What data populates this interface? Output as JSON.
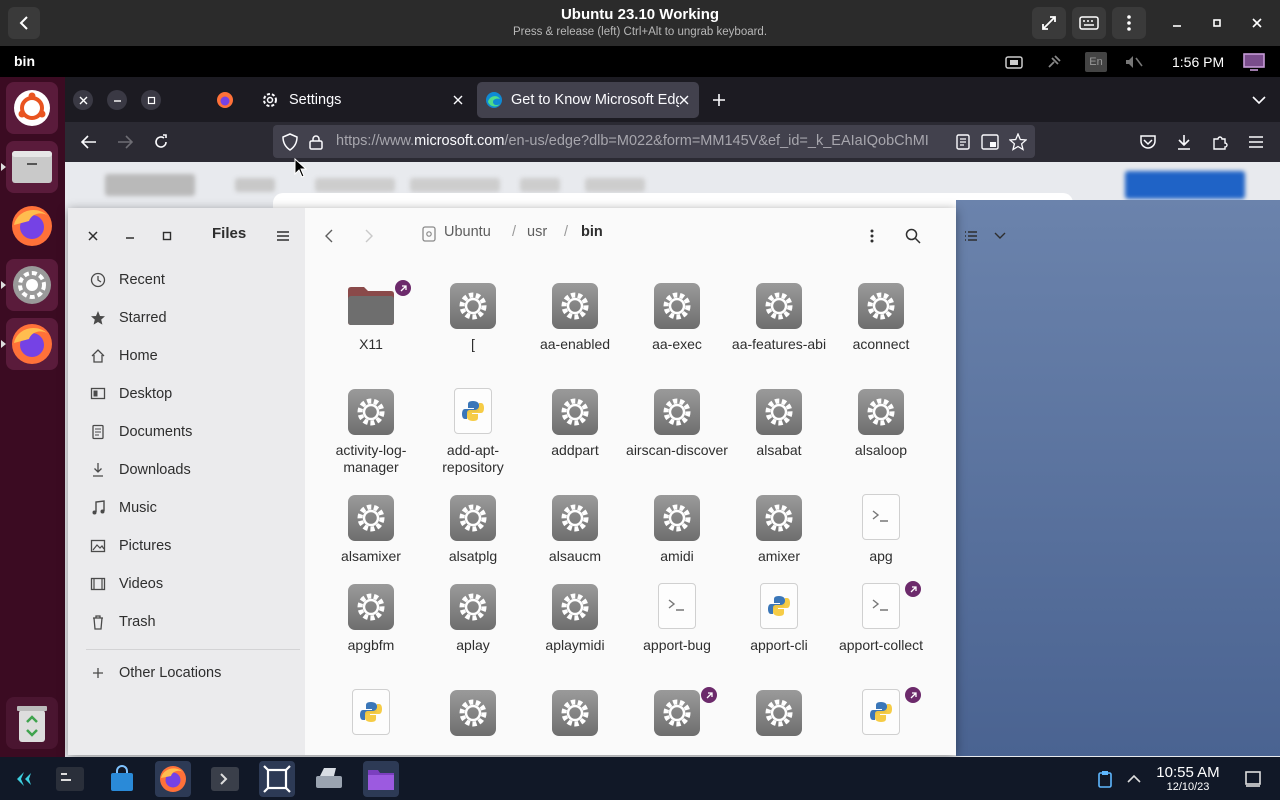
{
  "vm": {
    "title": "Ubuntu 23.10 Working",
    "subtitle": "Press & release (left) Ctrl+Alt to ungrab keyboard."
  },
  "topbar": {
    "app_name": "bin",
    "clock": "1:56 PM",
    "keyboard_layout": "En"
  },
  "firefox": {
    "tabs": [
      {
        "label": "Settings"
      },
      {
        "label": "Get to Know Microsoft Edge"
      }
    ],
    "url_prefix": "https://www.",
    "url_domain": "microsoft.com",
    "url_rest": "/en-us/edge?dlb=M022&form=MM145V&ef_id=_k_EAIaIQobChMI"
  },
  "files": {
    "title": "Files",
    "path": [
      "Ubuntu",
      "usr",
      "bin"
    ],
    "sidebar": [
      {
        "label": "Recent",
        "icon": "clock-icon"
      },
      {
        "label": "Starred",
        "icon": "star-icon"
      },
      {
        "label": "Home",
        "icon": "home-icon"
      },
      {
        "label": "Desktop",
        "icon": "desktop-icon"
      },
      {
        "label": "Documents",
        "icon": "documents-icon"
      },
      {
        "label": "Downloads",
        "icon": "downloads-icon"
      },
      {
        "label": "Music",
        "icon": "music-icon"
      },
      {
        "label": "Pictures",
        "icon": "pictures-icon"
      },
      {
        "label": "Videos",
        "icon": "videos-icon"
      },
      {
        "label": "Trash",
        "icon": "trash-icon"
      }
    ],
    "other_locations": "Other Locations",
    "items": [
      {
        "name": "X11",
        "type": "folder",
        "link": true
      },
      {
        "name": "[",
        "type": "exec",
        "link": false
      },
      {
        "name": "aa-enabled",
        "type": "exec",
        "link": false
      },
      {
        "name": "aa-exec",
        "type": "exec",
        "link": false
      },
      {
        "name": "aa-features-abi",
        "type": "exec",
        "link": false
      },
      {
        "name": "aconnect",
        "type": "exec",
        "link": false
      },
      {
        "name": "activity-log-manager",
        "type": "exec",
        "link": false
      },
      {
        "name": "add-apt-repository",
        "type": "python",
        "link": false
      },
      {
        "name": "addpart",
        "type": "exec",
        "link": false
      },
      {
        "name": "airscan-discover",
        "type": "exec",
        "link": false
      },
      {
        "name": "alsabat",
        "type": "exec",
        "link": false
      },
      {
        "name": "alsaloop",
        "type": "exec",
        "link": false
      },
      {
        "name": "alsamixer",
        "type": "exec",
        "link": false
      },
      {
        "name": "alsatplg",
        "type": "exec",
        "link": false
      },
      {
        "name": "alsaucm",
        "type": "exec",
        "link": false
      },
      {
        "name": "amidi",
        "type": "exec",
        "link": false
      },
      {
        "name": "amixer",
        "type": "exec",
        "link": false
      },
      {
        "name": "apg",
        "type": "script",
        "link": false
      },
      {
        "name": "apgbfm",
        "type": "exec",
        "link": false
      },
      {
        "name": "aplay",
        "type": "exec",
        "link": false
      },
      {
        "name": "aplaymidi",
        "type": "exec",
        "link": false
      },
      {
        "name": "apport-bug",
        "type": "script",
        "link": false
      },
      {
        "name": "apport-cli",
        "type": "python",
        "link": false
      },
      {
        "name": "apport-collect",
        "type": "script",
        "link": true
      },
      {
        "name": "",
        "type": "python",
        "link": false
      },
      {
        "name": "",
        "type": "exec",
        "link": false
      },
      {
        "name": "",
        "type": "exec",
        "link": false
      },
      {
        "name": "",
        "type": "exec",
        "link": true
      },
      {
        "name": "",
        "type": "exec",
        "link": false
      },
      {
        "name": "",
        "type": "python",
        "link": true
      }
    ]
  },
  "taskbar": {
    "time": "10:55 AM",
    "date": "12/10/23"
  },
  "colors": {
    "dock": "#3b0b22",
    "accent_badge": "#6c2a6b",
    "firefox_chrome": "#2b2a33"
  }
}
